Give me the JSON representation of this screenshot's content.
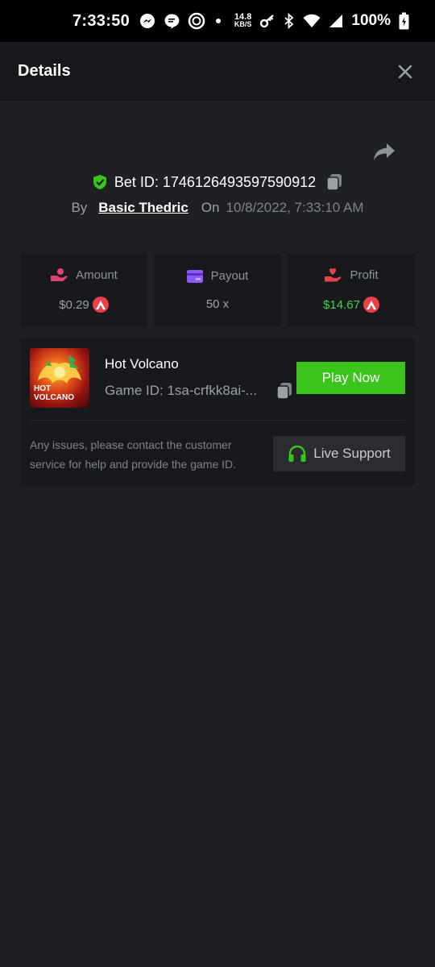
{
  "status_bar": {
    "time": "7:33:50",
    "net_speed_value": "14.8",
    "net_speed_unit": "KB/S",
    "battery": "100%"
  },
  "header": {
    "title": "Details"
  },
  "bet": {
    "id_label": "Bet ID: 1746126493597590912",
    "by_label": "By",
    "user": "Basic Thedric",
    "on_label": "On",
    "date": "10/8/2022, 7:33:10 AM"
  },
  "stats": [
    {
      "label": "Amount",
      "value": "$0.29",
      "icon": "hand-coin-icon",
      "color": "#e0427a"
    },
    {
      "label": "Payout",
      "value": "50 x",
      "icon": "card-icon",
      "color": "#8b5cf6"
    },
    {
      "label": "Profit",
      "value": "$14.67",
      "icon": "hand-heart-icon",
      "color": "#e8414a"
    }
  ],
  "game": {
    "title": "Hot Volcano",
    "game_id": "Game ID: 1sa-crfkk8ai-...",
    "play_label": "Play Now",
    "thumb_text_line1": "HOT",
    "thumb_text_line2": "VOLCANO"
  },
  "support": {
    "help_text": "Any issues, please contact the customer service for help and provide the game ID.",
    "button_label": "Live Support"
  },
  "colors": {
    "accent_green": "#3bc41c",
    "profit_green": "#3fd14a",
    "coin_red": "#e8414a",
    "background": "#1f2024",
    "card": "#18191c"
  }
}
